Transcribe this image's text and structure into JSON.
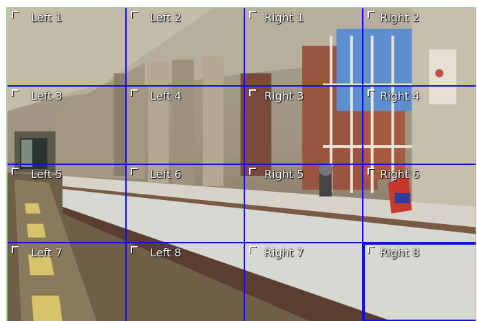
{
  "colors": {
    "grid_line": "#1010d8",
    "label_text": "#ffffff",
    "frame_left": "#a0d7a0",
    "frame_right": "#e7a0a0"
  },
  "icons": {
    "cell_marker": "corner-bracket-icon"
  },
  "regions": [
    {
      "label": "Left 1"
    },
    {
      "label": "Left 2"
    },
    {
      "label": "Right 1"
    },
    {
      "label": "Right 2"
    },
    {
      "label": "Left 3"
    },
    {
      "label": "Left 4"
    },
    {
      "label": "Right 3"
    },
    {
      "label": "Right 4"
    },
    {
      "label": "Left 5"
    },
    {
      "label": "Left 6"
    },
    {
      "label": "Right 5"
    },
    {
      "label": "Right 6"
    },
    {
      "label": "Left 7"
    },
    {
      "label": "Left 8"
    },
    {
      "label": "Right 7"
    },
    {
      "label": "Right 8"
    }
  ]
}
